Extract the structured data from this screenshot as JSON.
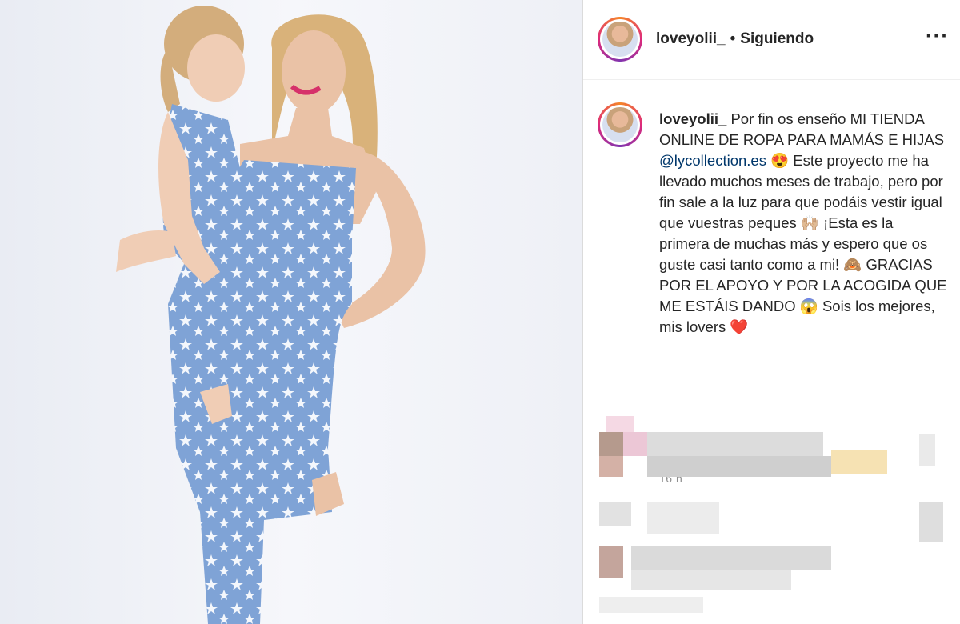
{
  "post": {
    "username": "loveyolii_",
    "separator": "•",
    "follow_status": "Siguiendo",
    "more_icon": "···",
    "caption_user": "loveyolii_",
    "caption_part1": " Por fin os enseño MI TIENDA ONLINE DE ROPA PARA MAMÁS E HIJAS ",
    "mention": "@lycollection.es",
    "caption_part2": " 😍 Este proyecto me ha llevado muchos meses de trabajo, pero por fin sale a la luz para que podáis vestir igual que vuestras peques 🙌🏼  ¡Esta es la primera de muchas más y espero que os guste casi tanto como a mi! 🙈  GRACIAS POR EL APOYO Y POR LA ACOGIDA QUE ME ESTÁIS DANDO 😱  Sois los mejores, mis lovers ❤️",
    "time": "16 h"
  },
  "colors": {
    "photo_bg": "#f1f3f8",
    "outfit_blue": "#7fa3d6",
    "mention": "#00376b",
    "muted": "#8e8e8e"
  }
}
